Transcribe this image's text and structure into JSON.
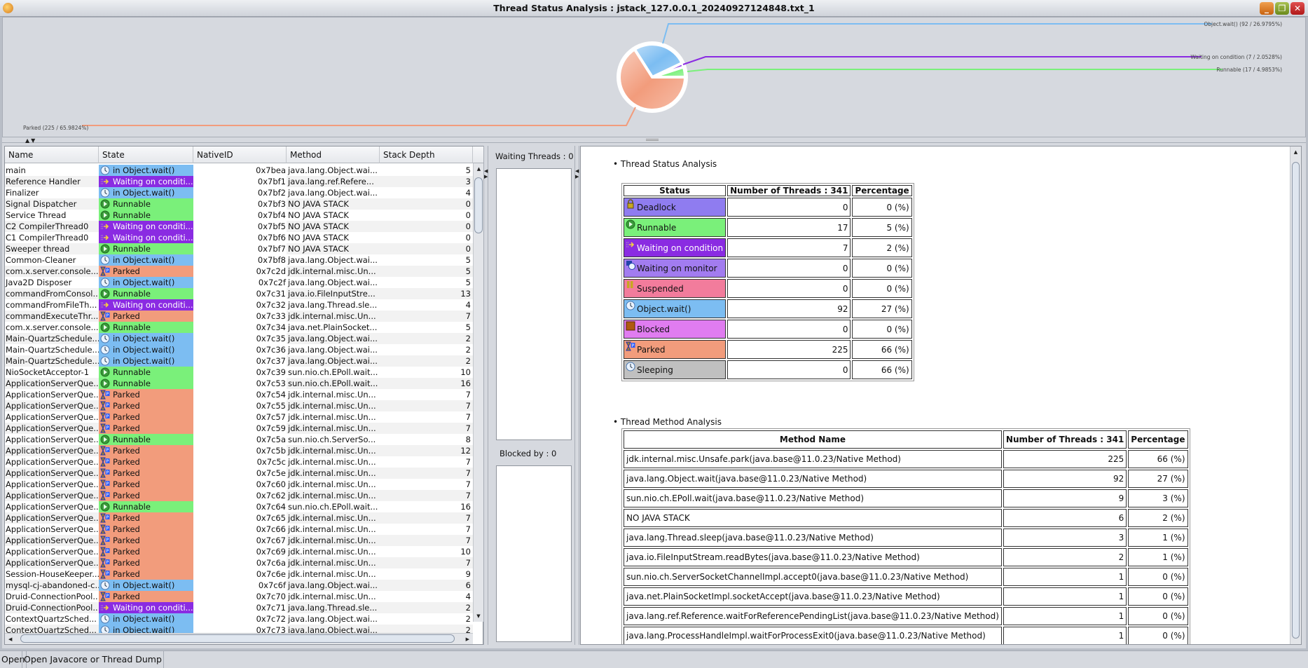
{
  "window": {
    "title": "Thread Status Analysis : jstack_127.0.0.1_20240927124848.txt_1"
  },
  "colors": {
    "runnable": "#7af07a",
    "waiting_condition": "#8a2be2",
    "object_wait": "#7cbdf2",
    "parked": "#f29c7c",
    "deadlock": "#8f7cf0",
    "waiting_monitor": "#a27cf0",
    "suspended": "#f27c9c",
    "blocked": "#e07cf0",
    "sleeping": "#c0c0c0"
  },
  "chart_data": {
    "type": "pie",
    "slices": [
      {
        "name": "Runnable",
        "value": 17,
        "percent": 4.9853,
        "label": "Runnable (17  / 4.9853%)",
        "color": "#7af07a"
      },
      {
        "name": "Waiting on condition",
        "value": 7,
        "percent": 2.0528,
        "label": "Waiting on condition (7  / 2.0528%)",
        "color": "#8a2be2"
      },
      {
        "name": "Object.wait()",
        "value": 92,
        "percent": 26.9795,
        "label": "Object.wait() (92  / 26.9795%)",
        "color": "#7cbdf2"
      },
      {
        "name": "Parked",
        "value": 225,
        "percent": 65.9824,
        "label": "Parked (225  / 65.9824%)",
        "color": "#f29c7c"
      }
    ]
  },
  "thread_table": {
    "columns": [
      "Name",
      "State",
      "NativeID",
      "Method",
      "Stack Depth"
    ],
    "state_labels": {
      "obj": "in Object.wait()",
      "cond": "Waiting on conditi...",
      "run": "Runnable",
      "park": "Parked"
    },
    "rows": [
      [
        "main",
        "obj",
        "0x7bea",
        "java.lang.Object.wai...",
        "5"
      ],
      [
        "Reference Handler",
        "cond",
        "0x7bf1",
        "java.lang.ref.Refere...",
        "3"
      ],
      [
        "Finalizer",
        "obj",
        "0x7bf2",
        "java.lang.Object.wai...",
        "4"
      ],
      [
        "Signal Dispatcher",
        "run",
        "0x7bf3",
        "NO JAVA STACK",
        "0"
      ],
      [
        "Service Thread",
        "run",
        "0x7bf4",
        "NO JAVA STACK",
        "0"
      ],
      [
        "C2 CompilerThread0",
        "cond",
        "0x7bf5",
        "NO JAVA STACK",
        "0"
      ],
      [
        "C1 CompilerThread0",
        "cond",
        "0x7bf6",
        "NO JAVA STACK",
        "0"
      ],
      [
        "Sweeper thread",
        "run",
        "0x7bf7",
        "NO JAVA STACK",
        "0"
      ],
      [
        "Common-Cleaner",
        "obj",
        "0x7bf8",
        "java.lang.Object.wai...",
        "5"
      ],
      [
        "com.x.server.console...",
        "park",
        "0x7c2d",
        "jdk.internal.misc.Un...",
        "5"
      ],
      [
        "Java2D Disposer",
        "obj",
        "0x7c2f",
        "java.lang.Object.wai...",
        "5"
      ],
      [
        "commandFromConsol...",
        "run",
        "0x7c31",
        "java.io.FileInputStre...",
        "13"
      ],
      [
        "commandFromFileTh...",
        "cond",
        "0x7c32",
        "java.lang.Thread.sle...",
        "4"
      ],
      [
        "commandExecuteThr...",
        "park",
        "0x7c33",
        "jdk.internal.misc.Un...",
        "7"
      ],
      [
        "com.x.server.console...",
        "run",
        "0x7c34",
        "java.net.PlainSocket...",
        "5"
      ],
      [
        "Main-QuartzSchedule...",
        "obj",
        "0x7c35",
        "java.lang.Object.wai...",
        "2"
      ],
      [
        "Main-QuartzSchedule...",
        "obj",
        "0x7c36",
        "java.lang.Object.wai...",
        "2"
      ],
      [
        "Main-QuartzSchedule...",
        "obj",
        "0x7c37",
        "java.lang.Object.wai...",
        "2"
      ],
      [
        "NioSocketAcceptor-1",
        "run",
        "0x7c39",
        "sun.nio.ch.EPoll.wait...",
        "10"
      ],
      [
        "ApplicationServerQue...",
        "run",
        "0x7c53",
        "sun.nio.ch.EPoll.wait...",
        "16"
      ],
      [
        "ApplicationServerQue...",
        "park",
        "0x7c54",
        "jdk.internal.misc.Un...",
        "7"
      ],
      [
        "ApplicationServerQue...",
        "park",
        "0x7c55",
        "jdk.internal.misc.Un...",
        "7"
      ],
      [
        "ApplicationServerQue...",
        "park",
        "0x7c57",
        "jdk.internal.misc.Un...",
        "7"
      ],
      [
        "ApplicationServerQue...",
        "park",
        "0x7c59",
        "jdk.internal.misc.Un...",
        "7"
      ],
      [
        "ApplicationServerQue...",
        "run",
        "0x7c5a",
        "sun.nio.ch.ServerSo...",
        "8"
      ],
      [
        "ApplicationServerQue...",
        "park",
        "0x7c5b",
        "jdk.internal.misc.Un...",
        "12"
      ],
      [
        "ApplicationServerQue...",
        "park",
        "0x7c5c",
        "jdk.internal.misc.Un...",
        "7"
      ],
      [
        "ApplicationServerQue...",
        "park",
        "0x7c5e",
        "jdk.internal.misc.Un...",
        "7"
      ],
      [
        "ApplicationServerQue...",
        "park",
        "0x7c60",
        "jdk.internal.misc.Un...",
        "7"
      ],
      [
        "ApplicationServerQue...",
        "park",
        "0x7c62",
        "jdk.internal.misc.Un...",
        "7"
      ],
      [
        "ApplicationServerQue...",
        "run",
        "0x7c64",
        "sun.nio.ch.EPoll.wait...",
        "16"
      ],
      [
        "ApplicationServerQue...",
        "park",
        "0x7c65",
        "jdk.internal.misc.Un...",
        "7"
      ],
      [
        "ApplicationServerQue...",
        "park",
        "0x7c66",
        "jdk.internal.misc.Un...",
        "7"
      ],
      [
        "ApplicationServerQue...",
        "park",
        "0x7c67",
        "jdk.internal.misc.Un...",
        "7"
      ],
      [
        "ApplicationServerQue...",
        "park",
        "0x7c69",
        "jdk.internal.misc.Un...",
        "10"
      ],
      [
        "ApplicationServerQue...",
        "park",
        "0x7c6a",
        "jdk.internal.misc.Un...",
        "7"
      ],
      [
        "Session-HouseKeeper...",
        "park",
        "0x7c6e",
        "jdk.internal.misc.Un...",
        "9"
      ],
      [
        "mysql-cj-abandoned-c...",
        "obj",
        "0x7c6f",
        "java.lang.Object.wai...",
        "6"
      ],
      [
        "Druid-ConnectionPool...",
        "park",
        "0x7c70",
        "jdk.internal.misc.Un...",
        "4"
      ],
      [
        "Druid-ConnectionPool...",
        "cond",
        "0x7c71",
        "java.lang.Thread.sle...",
        "2"
      ],
      [
        "ContextQuartzSched...",
        "obj",
        "0x7c72",
        "java.lang.Object.wai...",
        "2"
      ],
      [
        "ContextQuartzSched...",
        "obj",
        "0x7c73",
        "java.lang.Object.wai...",
        "2"
      ]
    ]
  },
  "middle": {
    "waiting_threads": "Waiting Threads : 0",
    "blocked_by": "Blocked by : 0"
  },
  "status_analysis": {
    "title": "Thread Status Analysis",
    "headers": [
      "Status",
      "Number of Threads : 341",
      "Percentage"
    ],
    "rows": [
      {
        "key": "deadlock",
        "icon": "lock-icon",
        "status": "Deadlock",
        "count": "0",
        "pct": "0 (%)"
      },
      {
        "key": "runnable",
        "icon": "play-icon",
        "status": "Runnable",
        "count": "17",
        "pct": "5 (%)"
      },
      {
        "key": "waiting_condition",
        "icon": "arrow-icon",
        "status": "Waiting on condition",
        "count": "7",
        "pct": "2 (%)"
      },
      {
        "key": "waiting_monitor",
        "icon": "monitor-clock-icon",
        "status": "Waiting on monitor",
        "count": "0",
        "pct": "0 (%)"
      },
      {
        "key": "suspended",
        "icon": "pause-icon",
        "status": "Suspended",
        "count": "0",
        "pct": "0 (%)"
      },
      {
        "key": "object_wait",
        "icon": "clock-icon",
        "status": "Object.wait()",
        "count": "92",
        "pct": "27 (%)"
      },
      {
        "key": "blocked",
        "icon": "blocked-square-icon",
        "status": "Blocked",
        "count": "0",
        "pct": "0 (%)"
      },
      {
        "key": "parked",
        "icon": "hourglass-p-icon",
        "status": "Parked",
        "count": "225",
        "pct": "66 (%)"
      },
      {
        "key": "sleeping",
        "icon": "clock-icon",
        "status": "Sleeping",
        "count": "0",
        "pct": "66 (%)"
      }
    ]
  },
  "method_analysis": {
    "title": "Thread Method Analysis",
    "headers": [
      "Method Name",
      "Number of Threads : 341",
      "Percentage"
    ],
    "rows": [
      {
        "method": "jdk.internal.misc.Unsafe.park(java.base@11.0.23/Native Method)",
        "count": "225",
        "pct": "66 (%)"
      },
      {
        "method": "java.lang.Object.wait(java.base@11.0.23/Native Method)",
        "count": "92",
        "pct": "27 (%)"
      },
      {
        "method": "sun.nio.ch.EPoll.wait(java.base@11.0.23/Native Method)",
        "count": "9",
        "pct": "3 (%)"
      },
      {
        "method": "NO JAVA STACK",
        "count": "6",
        "pct": "2 (%)"
      },
      {
        "method": "java.lang.Thread.sleep(java.base@11.0.23/Native Method)",
        "count": "3",
        "pct": "1 (%)"
      },
      {
        "method": "java.io.FileInputStream.readBytes(java.base@11.0.23/Native Method)",
        "count": "2",
        "pct": "1 (%)"
      },
      {
        "method": "sun.nio.ch.ServerSocketChannelImpl.accept0(java.base@11.0.23/Native Method)",
        "count": "1",
        "pct": "0 (%)"
      },
      {
        "method": "java.net.PlainSocketImpl.socketAccept(java.base@11.0.23/Native Method)",
        "count": "1",
        "pct": "0 (%)"
      },
      {
        "method": "java.lang.ref.Reference.waitForReferencePendingList(java.base@11.0.23/Native Method)",
        "count": "1",
        "pct": "0 (%)"
      },
      {
        "method": "java.lang.ProcessHandleImpl.waitForProcessExit0(java.base@11.0.23/Native Method)",
        "count": "1",
        "pct": "0 (%)"
      }
    ]
  },
  "statusbar": {
    "open_button": "Open",
    "message": "Open Javacore or Thread Dump"
  }
}
